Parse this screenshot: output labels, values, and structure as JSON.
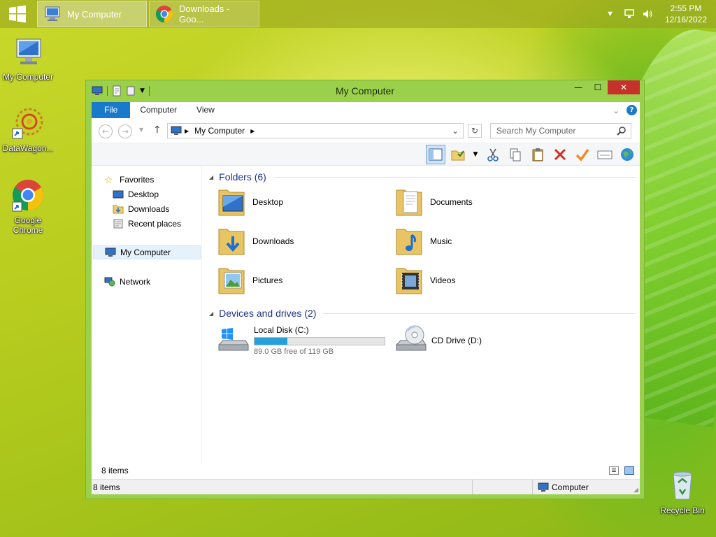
{
  "taskbar": {
    "tasks": [
      {
        "label": "My Computer"
      },
      {
        "label": "Downloads - Goo..."
      }
    ],
    "clock": {
      "time": "2:55 PM",
      "date": "12/16/2022"
    }
  },
  "desktop": {
    "icons": [
      {
        "label": "My Computer",
        "icon": "computer-icon"
      },
      {
        "label": "DataWagon...",
        "icon": "datawagon-icon"
      },
      {
        "label": "Google Chrome",
        "icon": "chrome-icon"
      },
      {
        "label": "Recycle Bin",
        "icon": "recycle-bin-icon"
      }
    ]
  },
  "window": {
    "title": "My Computer",
    "ribbon_tabs": [
      "File",
      "Computer",
      "View"
    ],
    "address": {
      "location": "My Computer"
    },
    "search": {
      "placeholder": "Search My Computer"
    },
    "nav": {
      "favorites": "Favorites",
      "items": [
        "Desktop",
        "Downloads",
        "Recent places"
      ],
      "computer": "My Computer",
      "network": "Network"
    },
    "groups": {
      "folders": "Folders (6)",
      "drives": "Devices and drives (2)"
    },
    "folders": [
      "Desktop",
      "Documents",
      "Downloads",
      "Music",
      "Pictures",
      "Videos"
    ],
    "drives": [
      {
        "name": "Local Disk (C:)",
        "free": "89.0 GB free of 119 GB",
        "used_fraction": 0.25
      },
      {
        "name": "CD Drive (D:)"
      }
    ],
    "status_items": "8 items",
    "statusbar": {
      "items": "8 items",
      "location": "Computer"
    }
  },
  "colors": {
    "accent": "#1979ca",
    "window_frame": "#9bd14a",
    "close": "#c7312b",
    "drive_bar": "#26a0da"
  }
}
